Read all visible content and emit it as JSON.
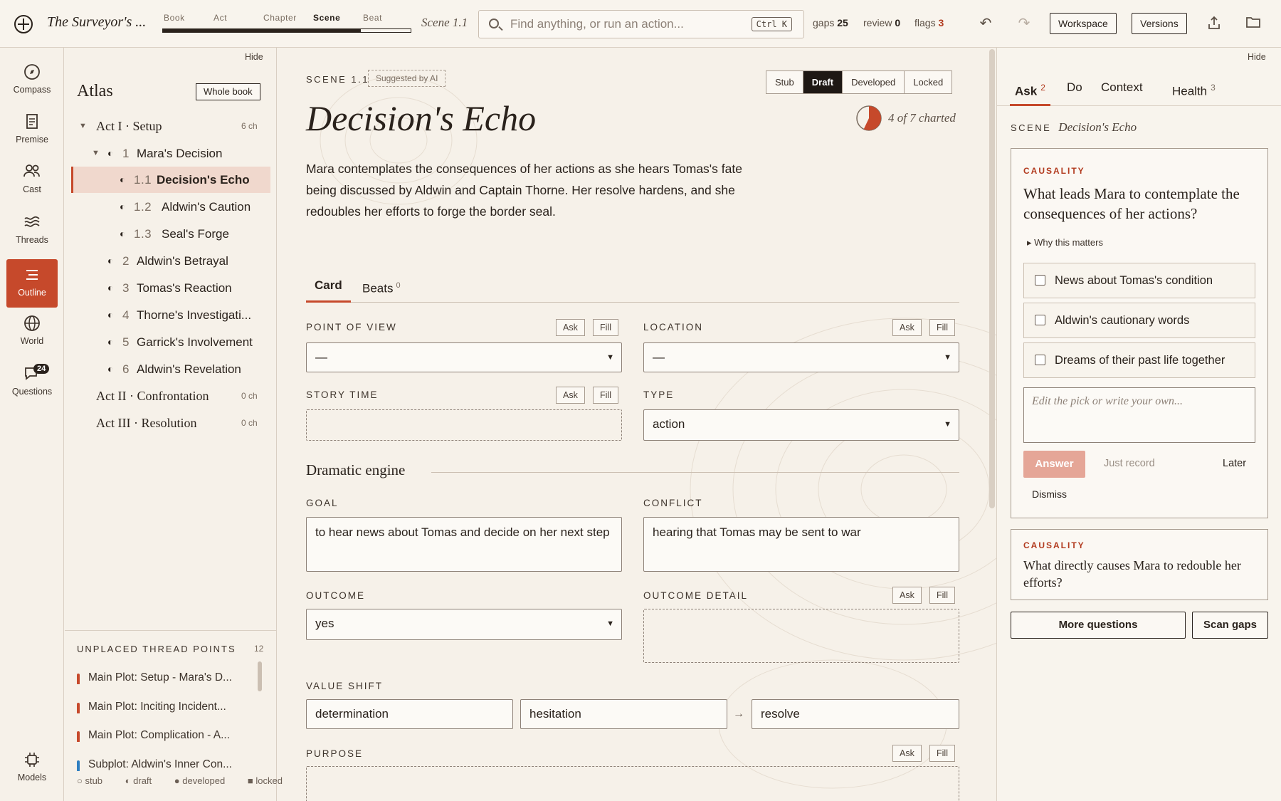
{
  "topbar": {
    "book_title": "The Surveyor's ...",
    "levels": [
      "Book",
      "Act",
      "Chapter",
      "Scene",
      "Beat"
    ],
    "active_level": "Scene",
    "level_progress": 0.8,
    "scene_ref": "Scene 1.1",
    "search_placeholder": "Find anything, or run an action...",
    "search_shortcut": "Ctrl K",
    "gaps_label": "gaps",
    "gaps_value": "25",
    "review_label": "review",
    "review_value": "0",
    "flags_label": "flags",
    "flags_value": "3",
    "undo_icon": "undo-icon",
    "redo_icon": "redo-icon",
    "workspace_label": "Workspace",
    "versions_label": "Versions",
    "share_icon": "share-icon",
    "folder_icon": "folder-icon"
  },
  "rail": {
    "items": [
      {
        "label": "Compass",
        "icon": "compass-icon"
      },
      {
        "label": "Premise",
        "icon": "document-icon"
      },
      {
        "label": "Cast",
        "icon": "people-icon"
      },
      {
        "label": "Threads",
        "icon": "threads-icon"
      },
      {
        "label": "Outline",
        "icon": "outline-icon",
        "active": true
      },
      {
        "label": "World",
        "icon": "globe-icon"
      },
      {
        "label": "Questions",
        "icon": "chat-icon",
        "badge": "24"
      }
    ],
    "models_label": "Models"
  },
  "atlas": {
    "hide_label": "Hide",
    "title": "Atlas",
    "scope_button": "Whole book",
    "act1": {
      "label": "Act I · Setup",
      "count": "6 ch"
    },
    "ch1": {
      "num": "1",
      "label": "Mara's Decision"
    },
    "scenes": [
      {
        "num": "1.1",
        "label": "Decision's Echo"
      },
      {
        "num": "1.2",
        "label": "Aldwin's Caution"
      },
      {
        "num": "1.3",
        "label": "Seal's Forge"
      }
    ],
    "chapters": [
      {
        "num": "2",
        "label": "Aldwin's Betrayal"
      },
      {
        "num": "3",
        "label": "Tomas's Reaction"
      },
      {
        "num": "4",
        "label": "Thorne's Investigati..."
      },
      {
        "num": "5",
        "label": "Garrick's Involvement"
      },
      {
        "num": "6",
        "label": "Aldwin's Revelation"
      }
    ],
    "act2": {
      "label": "Act II · Confrontation",
      "count": "0 ch"
    },
    "act3": {
      "label": "Act III · Resolution",
      "count": "0 ch"
    },
    "unplaced_title": "UNPLACED THREAD POINTS",
    "unplaced_count": "12",
    "thread_points": [
      {
        "label": "Main Plot: Setup - Mara's D...",
        "color": "#c6492b"
      },
      {
        "label": "Main Plot: Inciting Incident...",
        "color": "#c6492b"
      },
      {
        "label": "Main Plot: Complication - A...",
        "color": "#c6492b"
      },
      {
        "label": "Subplot: Aldwin's Inner Con...",
        "color": "#2f7fc1"
      }
    ],
    "legend": [
      "stub",
      "draft",
      "developed",
      "locked"
    ]
  },
  "main": {
    "kicker": "SCENE 1.1",
    "suggested": "Suggested by AI",
    "status_options": [
      "Stub",
      "Draft",
      "Developed",
      "Locked"
    ],
    "status_selected": "Draft",
    "title": "Decision's Echo",
    "charted_text": "4 of 7 charted",
    "charted_fraction": 0.571,
    "summary": "Mara contemplates the consequences of her actions as she hears Tomas's fate being discussed by Aldwin and Captain Thorne. Her resolve hardens, and she redoubles her efforts to forge the border seal.",
    "tab_card": "Card",
    "tab_beats": "Beats",
    "beats_count": "0",
    "ask_label": "Ask",
    "fill_label": "Fill",
    "pov_label": "POINT OF VIEW",
    "pov_value": "—",
    "location_label": "LOCATION",
    "location_value": "—",
    "story_time_label": "STORY TIME",
    "story_time_value": "",
    "type_label": "TYPE",
    "type_value": "action",
    "section_title": "Dramatic engine",
    "goal_label": "GOAL",
    "goal_value": "to hear news about Tomas and decide on her next step",
    "conflict_label": "CONFLICT",
    "conflict_value": "hearing that Tomas may be sent to war",
    "outcome_label": "OUTCOME",
    "outcome_value": "yes",
    "outcome_detail_label": "OUTCOME DETAIL",
    "outcome_detail_value": "",
    "value_shift_label": "VALUE SHIFT",
    "value_shift_a": "determination",
    "value_shift_b": "hesitation",
    "value_shift_arrow": "→",
    "value_shift_c": "resolve",
    "purpose_label": "PURPOSE"
  },
  "right": {
    "hide_label": "Hide",
    "tabs": [
      {
        "label": "Ask",
        "count": "2"
      },
      {
        "label": "Do"
      },
      {
        "label": "Context"
      },
      {
        "label": "Health",
        "count": "3"
      }
    ],
    "scene_kicker": "SCENE",
    "scene_name": "Decision's Echo",
    "q1_category": "CAUSALITY",
    "q1_text": "What leads Mara to contemplate the consequences of her actions?",
    "why_label": "Why this matters",
    "options": [
      "News about Tomas's condition",
      "Aldwin's cautionary words",
      "Dreams of their past life together"
    ],
    "own_placeholder": "Edit the pick or write your own...",
    "answer_label": "Answer",
    "just_record_label": "Just record",
    "later_label": "Later",
    "dismiss_label": "Dismiss",
    "q2_category": "CAUSALITY",
    "q2_text": "What directly causes Mara to redouble her efforts?",
    "more_label": "More questions",
    "scan_label": "Scan gaps"
  }
}
